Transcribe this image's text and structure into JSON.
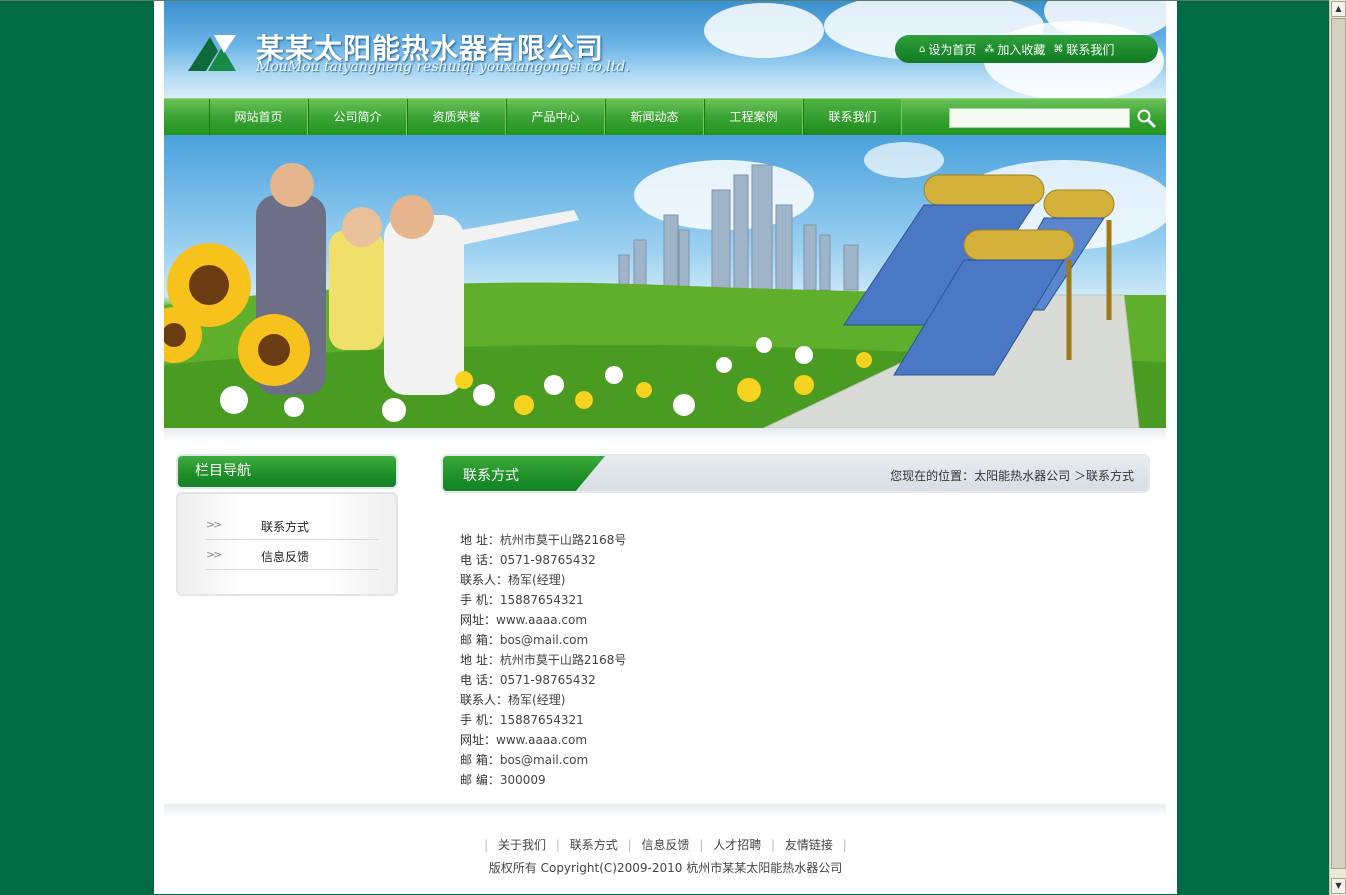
{
  "header": {
    "logo_cn": "某某太阳能热水器有限公司",
    "logo_en": "MouMou taiyangneng reshuiqi youxiangongsi co,ltd.",
    "toplinks": [
      {
        "label": "设为首页",
        "icon": "home-icon"
      },
      {
        "label": "加入收藏",
        "icon": "bookmark-icon"
      },
      {
        "label": "联系我们",
        "icon": "contact-icon"
      }
    ]
  },
  "nav": {
    "items": [
      {
        "label": "网站首页"
      },
      {
        "label": "公司简介"
      },
      {
        "label": "资质荣誉"
      },
      {
        "label": "产品中心"
      },
      {
        "label": "新闻动态"
      },
      {
        "label": "工程案例"
      },
      {
        "label": "联系我们"
      }
    ],
    "active_index": 6,
    "search_value": ""
  },
  "sidebar": {
    "title": "栏目导航",
    "items": [
      {
        "label": "联系方式"
      },
      {
        "label": "信息反馈"
      }
    ]
  },
  "main": {
    "title": "联系方式",
    "breadcrumb": "您现在的位置：太阳能热水器公司 ＞联系方式",
    "contact_lines": [
      {
        "key": "地 址：",
        "value": "杭州市莫干山路2168号"
      },
      {
        "key": "电 话：",
        "value": "0571-98765432"
      },
      {
        "key": "联系人：",
        "value": "杨军(经理)"
      },
      {
        "key": "手 机：",
        "value": "15887654321"
      },
      {
        "key": "网址：",
        "value": "www.aaaa.com"
      },
      {
        "key": "邮 箱：",
        "value": "bos@mail.com"
      },
      {
        "key": "地 址：",
        "value": "杭州市莫干山路2168号"
      },
      {
        "key": "电 话：",
        "value": "0571-98765432"
      },
      {
        "key": "联系人：",
        "value": "杨军(经理)"
      },
      {
        "key": "手 机：",
        "value": "15887654321"
      },
      {
        "key": "网址：",
        "value": "www.aaaa.com"
      },
      {
        "key": "邮 箱：",
        "value": "bos@mail.com"
      },
      {
        "key": "邮 编：",
        "value": "300009"
      }
    ]
  },
  "footer": {
    "links": [
      {
        "label": "关于我们"
      },
      {
        "label": "联系方式"
      },
      {
        "label": "信息反馈"
      },
      {
        "label": "人才招聘"
      },
      {
        "label": "友情链接"
      }
    ],
    "copyright": "版权所有  Copyright(C)2009-2010 杭州市某某太阳能热水器公司"
  },
  "colors": {
    "page_bg": "#006a45",
    "nav_green": "#2a9a26",
    "accent_green": "#1a8b26"
  }
}
